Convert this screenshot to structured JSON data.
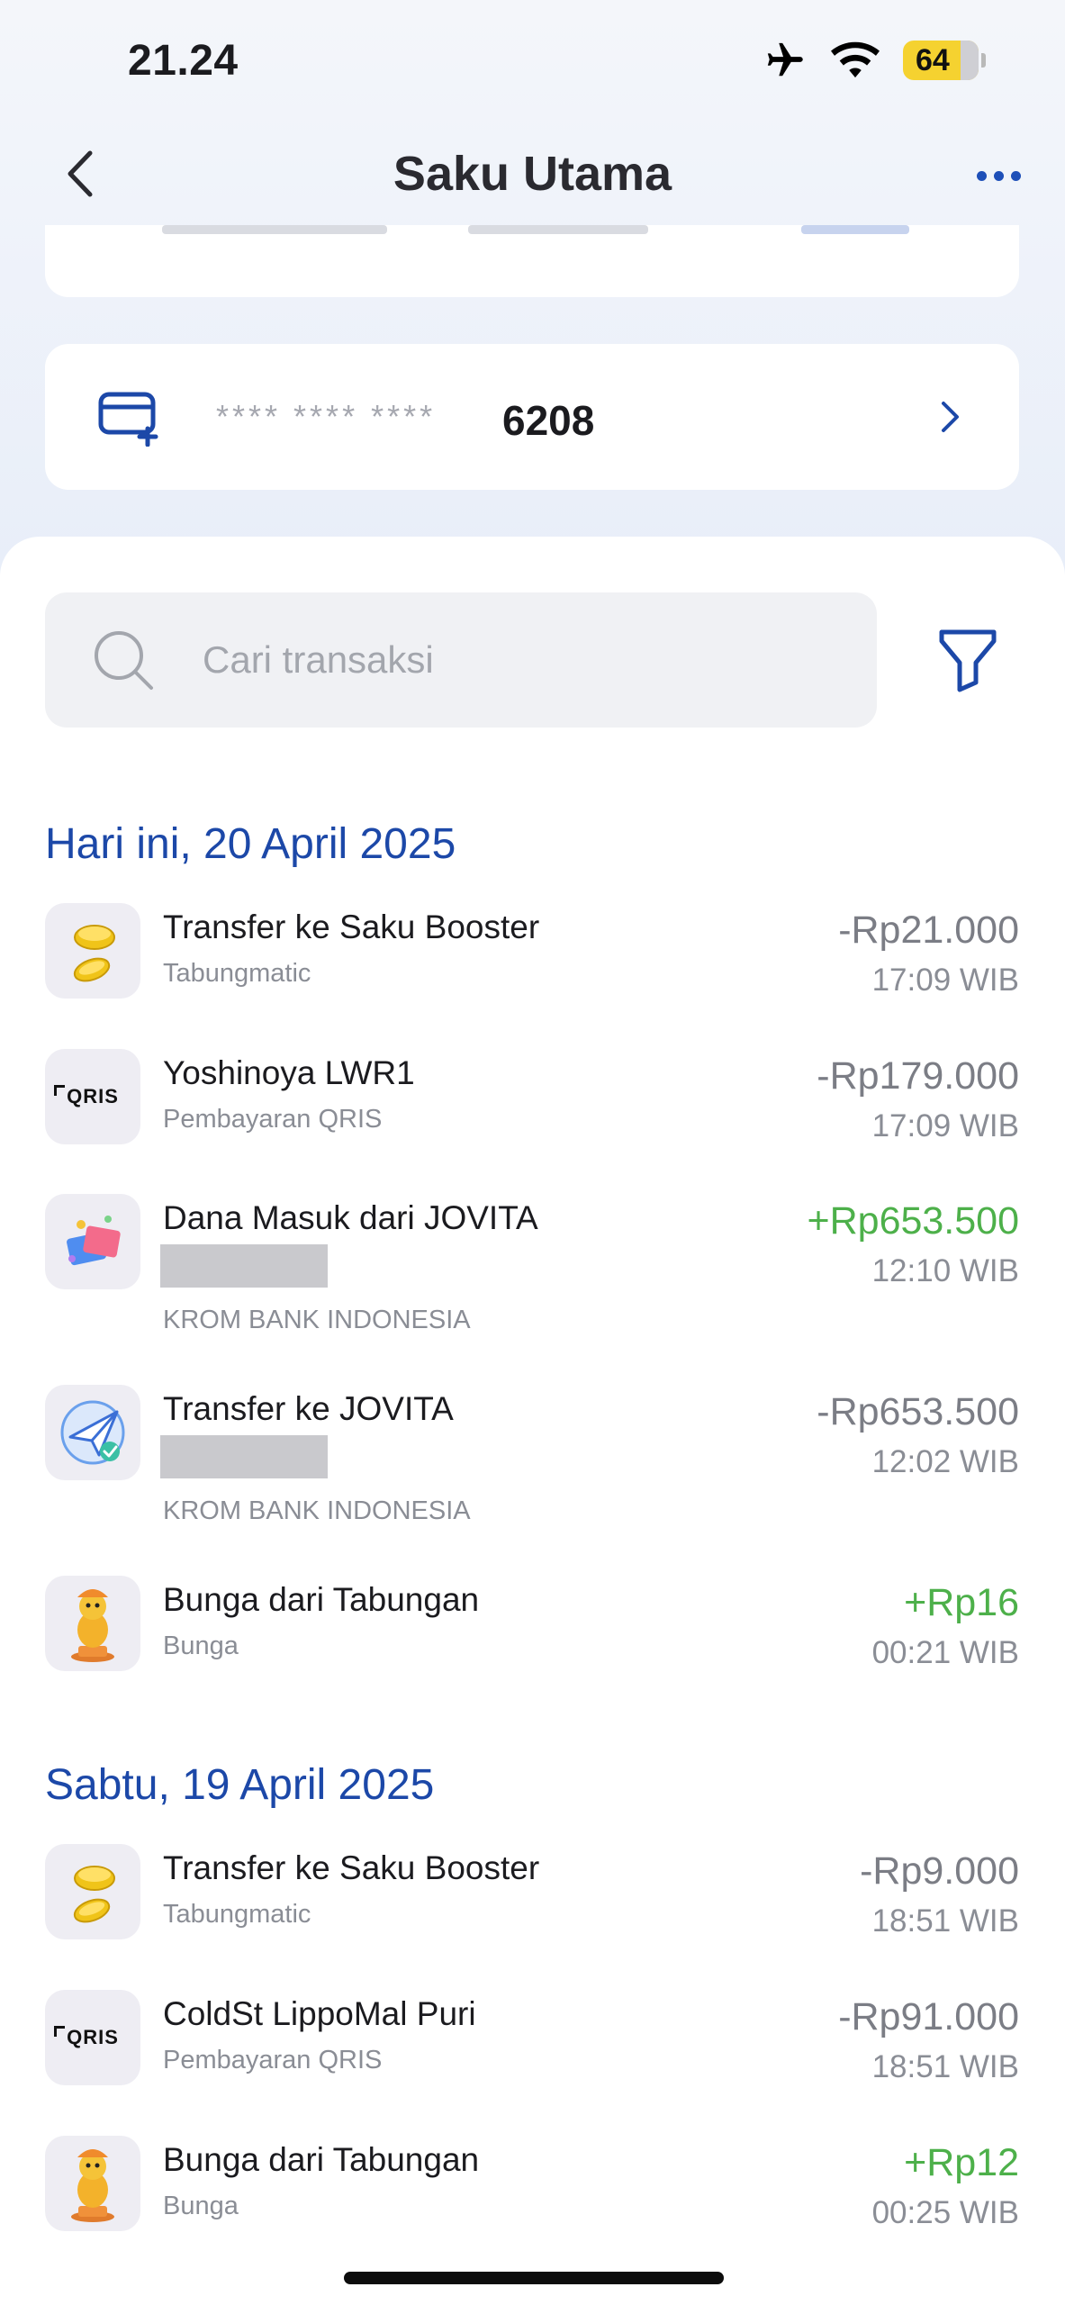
{
  "status_bar": {
    "time": "21.24",
    "battery": "64"
  },
  "nav": {
    "title": "Saku Utama"
  },
  "account_card": {
    "mask": "**** **** ****",
    "last4": "6208"
  },
  "search": {
    "placeholder": "Cari transaksi"
  },
  "groups": [
    {
      "date": "Hari ini, 20 April 2025",
      "items": [
        {
          "title": "Transfer ke Saku Booster",
          "subtitle": "Tabungmatic",
          "amount": "-Rp21.000",
          "time": "17:09 WIB",
          "icon": "coins-icon"
        },
        {
          "title": "Yoshinoya LWR1",
          "subtitle": "Pembayaran QRIS",
          "amount": "-Rp179.000",
          "time": "17:09 WIB",
          "icon": "qris-icon"
        },
        {
          "title": "Dana Masuk dari JOVITA",
          "bank": "KROM BANK INDONESIA",
          "amount": "+Rp653.500",
          "time": "12:10 WIB",
          "icon": "incoming-money-icon"
        },
        {
          "title": "Transfer ke JOVITA",
          "bank": "KROM BANK INDONESIA",
          "amount": "-Rp653.500",
          "time": "12:02 WIB",
          "icon": "paper-plane-icon"
        },
        {
          "title": "Bunga dari Tabungan",
          "subtitle": "Bunga",
          "amount": "+Rp16",
          "time": "00:21 WIB",
          "icon": "mascot-icon"
        }
      ]
    },
    {
      "date": "Sabtu, 19 April 2025",
      "items": [
        {
          "title": "Transfer ke Saku Booster",
          "subtitle": "Tabungmatic",
          "amount": "-Rp9.000",
          "time": "18:51 WIB",
          "icon": "coins-icon"
        },
        {
          "title": "ColdSt LippoMal Puri",
          "subtitle": "Pembayaran QRIS",
          "amount": "-Rp91.000",
          "time": "18:51 WIB",
          "icon": "qris-icon"
        },
        {
          "title": "Bunga dari Tabungan",
          "subtitle": "Bunga",
          "amount": "+Rp12",
          "time": "00:25 WIB",
          "icon": "mascot-icon"
        }
      ]
    }
  ],
  "colors": {
    "accent": "#1c48a8",
    "positive": "#4db04a",
    "negative": "#7b7d85"
  }
}
